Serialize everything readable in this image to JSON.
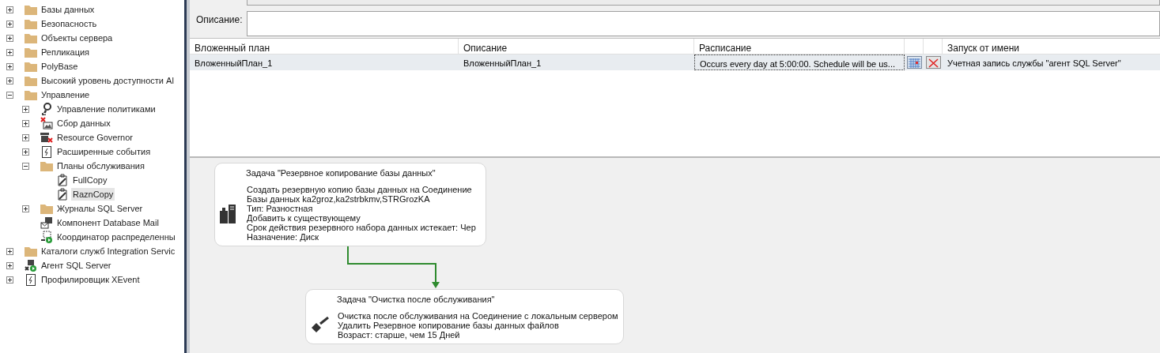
{
  "tree": [
    {
      "label": "Базы данных",
      "kind": "folder",
      "expanded": false,
      "selected": false
    },
    {
      "label": "Безопасность",
      "kind": "folder",
      "expanded": false,
      "selected": false
    },
    {
      "label": "Объекты сервера",
      "kind": "folder",
      "expanded": false,
      "selected": false
    },
    {
      "label": "Репликация",
      "kind": "folder",
      "expanded": false,
      "selected": false
    },
    {
      "label": "PolyBase",
      "kind": "folder",
      "expanded": false,
      "selected": false
    },
    {
      "label": "Высокий уровень доступности Al",
      "kind": "folder",
      "expanded": false,
      "selected": false
    },
    {
      "label": "Управление",
      "kind": "folder",
      "expanded": true,
      "selected": false,
      "children": [
        {
          "label": "Управление политиками",
          "kind": "policy",
          "expanded": false,
          "selected": false
        },
        {
          "label": "Сбор данных",
          "kind": "collection",
          "expanded": false,
          "selected": false
        },
        {
          "label": "Resource Governor",
          "kind": "governor",
          "expanded": false,
          "selected": false
        },
        {
          "label": "Расширенные события",
          "kind": "events",
          "expanded": false,
          "selected": false
        },
        {
          "label": "Планы обслуживания",
          "kind": "folder",
          "expanded": true,
          "selected": false,
          "children": [
            {
              "label": "FullCopy",
              "kind": "plan",
              "selected": false
            },
            {
              "label": "RaznCopy",
              "kind": "plan",
              "selected": true
            }
          ]
        },
        {
          "label": "Журналы SQL Server",
          "kind": "folder",
          "expanded": false,
          "selected": false
        },
        {
          "label": "Компонент Database Mail",
          "kind": "mail",
          "selected": false
        },
        {
          "label": "Координатор распределенны",
          "kind": "coordinator",
          "selected": false
        }
      ]
    },
    {
      "label": "Каталоги служб Integration Servic",
      "kind": "folder",
      "expanded": false,
      "selected": false
    },
    {
      "label": "Агент SQL Server",
      "kind": "agent",
      "expanded": false,
      "selected": false
    },
    {
      "label": "Профилировщик XEvent",
      "kind": "events",
      "expanded": false,
      "selected": false
    }
  ],
  "description": {
    "label": "Описание:"
  },
  "subplans": {
    "columns": [
      "Вложенный план",
      "Описание",
      "Расписание",
      "Запуск от имени"
    ],
    "rows": [
      {
        "name": "ВложенныйПлан_1",
        "description": "ВложенныйПлан_1",
        "schedule": "Occurs every day at 5:00:00. Schedule will be us...",
        "run_as": "Учетная запись службы \"агент SQL Server\"",
        "selected": true
      }
    ]
  },
  "tasks": [
    {
      "kind": "backup",
      "title": "Задача \"Резервное копирование базы данных\"",
      "lines": [
        "Создать резервную копию базы данных на Соединение",
        "Базы данных ka2groz,ka2strbkmv,STRGrozKA",
        "Тип: Разностная",
        "Добавить к существующему",
        "Срок действия резервного набора данных истекает: Чер",
        "Назначение: Диск"
      ]
    },
    {
      "kind": "cleanup",
      "title": "Задача \"Очистка после обслуживания\"",
      "lines": [
        "Очистка после обслуживания на Соединение с локальным сервером",
        "Удалить Резервное копирование базы данных файлов",
        "Возраст: старше, чем 15 Дней"
      ]
    }
  ]
}
